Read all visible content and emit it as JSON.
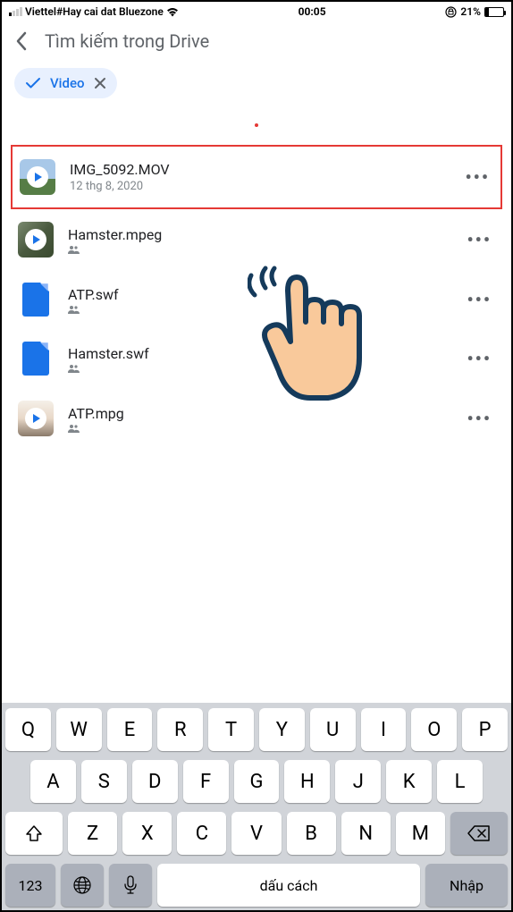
{
  "status": {
    "carrier": "Viettel#Hay cai dat Bluezone",
    "time": "00:05",
    "battery_pct": "21%",
    "battery_fill_pct": 21
  },
  "search": {
    "placeholder": "Tìm kiếm trong Drive"
  },
  "filter": {
    "label": "Video"
  },
  "files": [
    {
      "name": "IMG_5092.MOV",
      "meta": "12 thg 8, 2020",
      "shared": false,
      "thumb": "img",
      "highlighted": true
    },
    {
      "name": "Hamster.mpeg",
      "meta": "",
      "shared": true,
      "thumb": "hamster",
      "highlighted": false
    },
    {
      "name": "ATP.swf",
      "meta": "",
      "shared": true,
      "thumb": "doc",
      "highlighted": false
    },
    {
      "name": "Hamster.swf",
      "meta": "",
      "shared": true,
      "thumb": "doc",
      "highlighted": false
    },
    {
      "name": "ATP.mpg",
      "meta": "",
      "shared": true,
      "thumb": "atp",
      "highlighted": false
    }
  ],
  "keyboard": {
    "row1": [
      "Q",
      "W",
      "E",
      "R",
      "T",
      "Y",
      "U",
      "I",
      "O",
      "P"
    ],
    "row2": [
      "A",
      "S",
      "D",
      "F",
      "G",
      "H",
      "J",
      "K",
      "L"
    ],
    "row3": [
      "Z",
      "X",
      "C",
      "V",
      "B",
      "N",
      "M"
    ],
    "num_key": "123",
    "space": "dấu cách",
    "enter": "Nhập"
  }
}
